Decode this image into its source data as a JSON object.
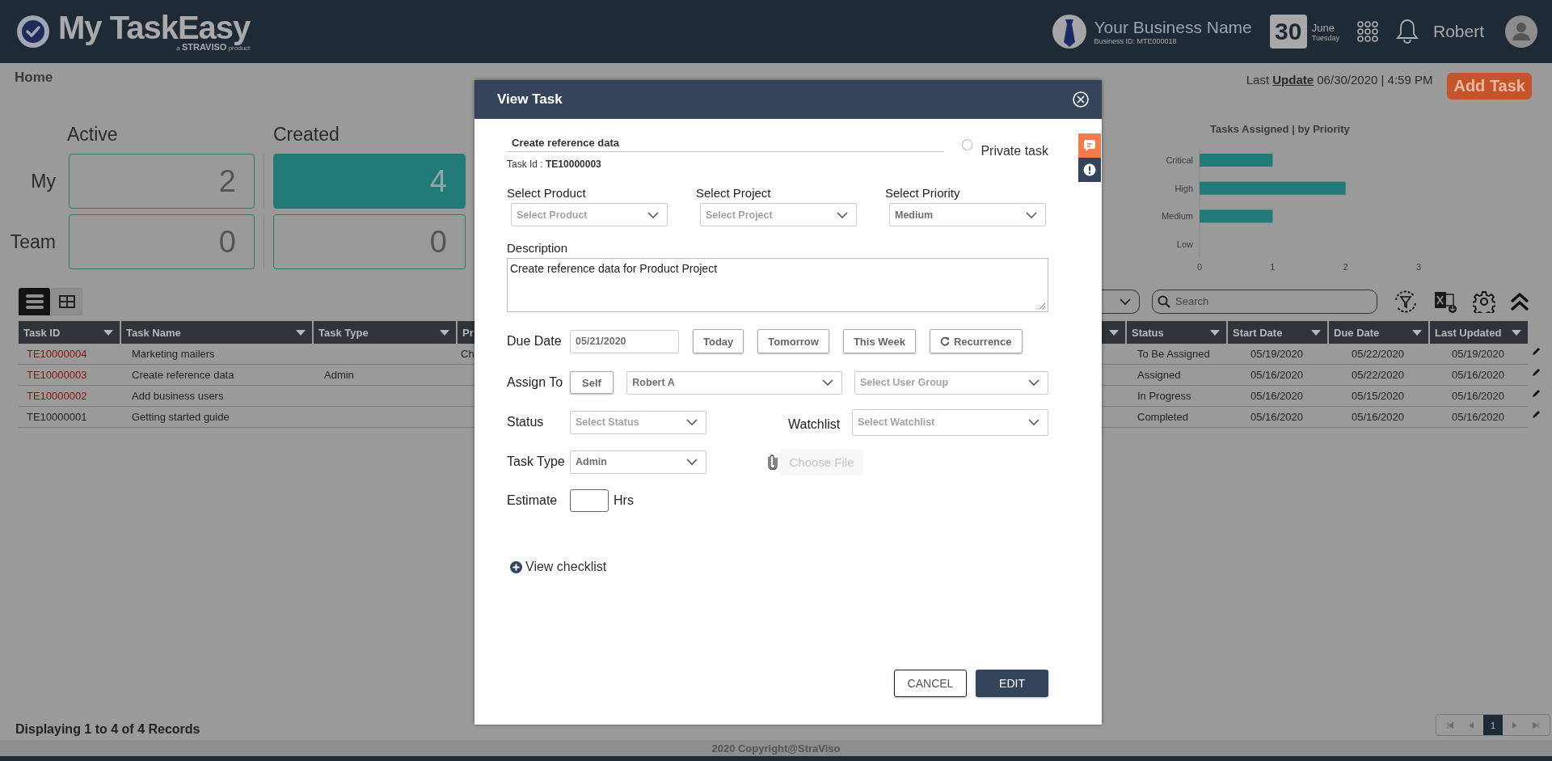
{
  "header": {
    "logo_name": "My TaskEasy",
    "logo_tagline": "a **STRAVISO** product",
    "business_name": "Your Business Name",
    "business_id": "Business ID: MTE000018",
    "date_day": "30",
    "date_month": "June",
    "date_weekday": "Tuesday",
    "user_name": "Robert"
  },
  "subbar": {
    "breadcrumb": "Home",
    "last_update_prefix": "Last",
    "last_update_link": "Update",
    "last_update_value": "06/30/2020 | 4:59 PM",
    "add_button": "Add Task"
  },
  "stats": {
    "columns": [
      "Active",
      "Created"
    ],
    "rows": [
      {
        "label": "My",
        "cards": [
          {
            "value": "2",
            "selected": false
          },
          {
            "value": "4",
            "selected": true
          }
        ]
      },
      {
        "label": "Team",
        "cards": [
          {
            "value": "0",
            "selected": false
          },
          {
            "value": "0",
            "selected": false
          }
        ]
      }
    ]
  },
  "chart": {
    "chart_data": {
      "type": "bar",
      "orientation": "horizontal",
      "title": "Tasks Assigned | by Priority",
      "categories": [
        "Critical",
        "High",
        "Medium",
        "Low"
      ],
      "values": [
        1,
        2,
        1,
        0
      ],
      "xlim": [
        0,
        3
      ],
      "xticks": [
        0,
        1,
        2,
        3
      ]
    }
  },
  "toolbar": {
    "view_modes": [
      {
        "kind": "list",
        "selected": true
      },
      {
        "kind": "grid",
        "selected": false
      }
    ],
    "search_placeholder": "Search"
  },
  "table": {
    "columns": [
      {
        "label": "Task ID"
      },
      {
        "label": "Task Name"
      },
      {
        "label": "Task Type"
      },
      {
        "label": "Pr"
      },
      {},
      {
        "label": "Status"
      },
      {
        "label": "Start Date"
      },
      {
        "label": "Due Date"
      },
      {
        "label": "Last Updated"
      }
    ],
    "rows": [
      {
        "flagged": true,
        "cells": [
          "TE10000004",
          "Marketing mailers",
          null,
          "Ch",
          null,
          "To Be Assigned",
          "05/19/2020",
          "05/22/2020",
          "05/19/2020"
        ]
      },
      {
        "flagged": true,
        "cells": [
          "TE10000003",
          "Create reference data",
          "Admin",
          null,
          null,
          "Assigned",
          "05/16/2020",
          "05/22/2020",
          "05/16/2020"
        ]
      },
      {
        "flagged": true,
        "cells": [
          "TE10000002",
          "Add business users",
          null,
          null,
          null,
          "In Progress",
          "05/16/2020",
          "05/15/2020",
          "05/16/2020"
        ]
      },
      {
        "flagged": false,
        "cells": [
          "TE10000001",
          "Getting started guide",
          null,
          null,
          null,
          "Completed",
          "05/16/2020",
          "05/16/2020",
          "05/16/2020"
        ]
      }
    ]
  },
  "footer": {
    "record_count": "Displaying 1 to 4 of 4 Records",
    "pages": [
      {
        "label": "1",
        "selected": true
      }
    ],
    "copyright": "2020 Copyright@StraViso"
  },
  "modal": {
    "title": "View Task",
    "task_name": "Create reference data",
    "private": {
      "label": "Private task",
      "checked": false
    },
    "task_id_label": "Task Id :",
    "task_id": "TE10000003",
    "selects": [
      {
        "label": "Select Product",
        "placeholder": "Select Product"
      },
      {
        "label": "Select Project",
        "placeholder": "Select Project"
      },
      {
        "label": "Select Priority",
        "value": "Medium"
      }
    ],
    "description": {
      "label": "Description",
      "value": "Create reference data for Product Project"
    },
    "due_date": {
      "label": "Due Date",
      "value": "05/21/2020",
      "buttons": [
        {
          "kind": "plain",
          "label": "Today"
        },
        {
          "kind": "plain",
          "label": "Tomorrow"
        },
        {
          "kind": "plain",
          "label": "This Week"
        },
        {
          "kind": "recurrence",
          "label": "Recurrence"
        }
      ]
    },
    "assign": {
      "label": "Assign To",
      "self_button": "Self",
      "user": {
        "value": "Robert A"
      },
      "group": {
        "placeholder": "Select User Group"
      }
    },
    "status": {
      "label": "Status",
      "placeholder": "Select Status"
    },
    "watchlist": {
      "label": "Watchlist",
      "placeholder": "Select Watchlist"
    },
    "task_type": {
      "label": "Task Type",
      "value": "Admin"
    },
    "file": {
      "label": "Choose File",
      "disabled": true
    },
    "estimate": {
      "label": "Estimate",
      "unit": "Hrs"
    },
    "checklist_link": "View checklist",
    "buttons": [
      {
        "kind": "secondary",
        "label": "CANCEL"
      },
      {
        "kind": "primary",
        "label": "EDIT"
      }
    ]
  }
}
